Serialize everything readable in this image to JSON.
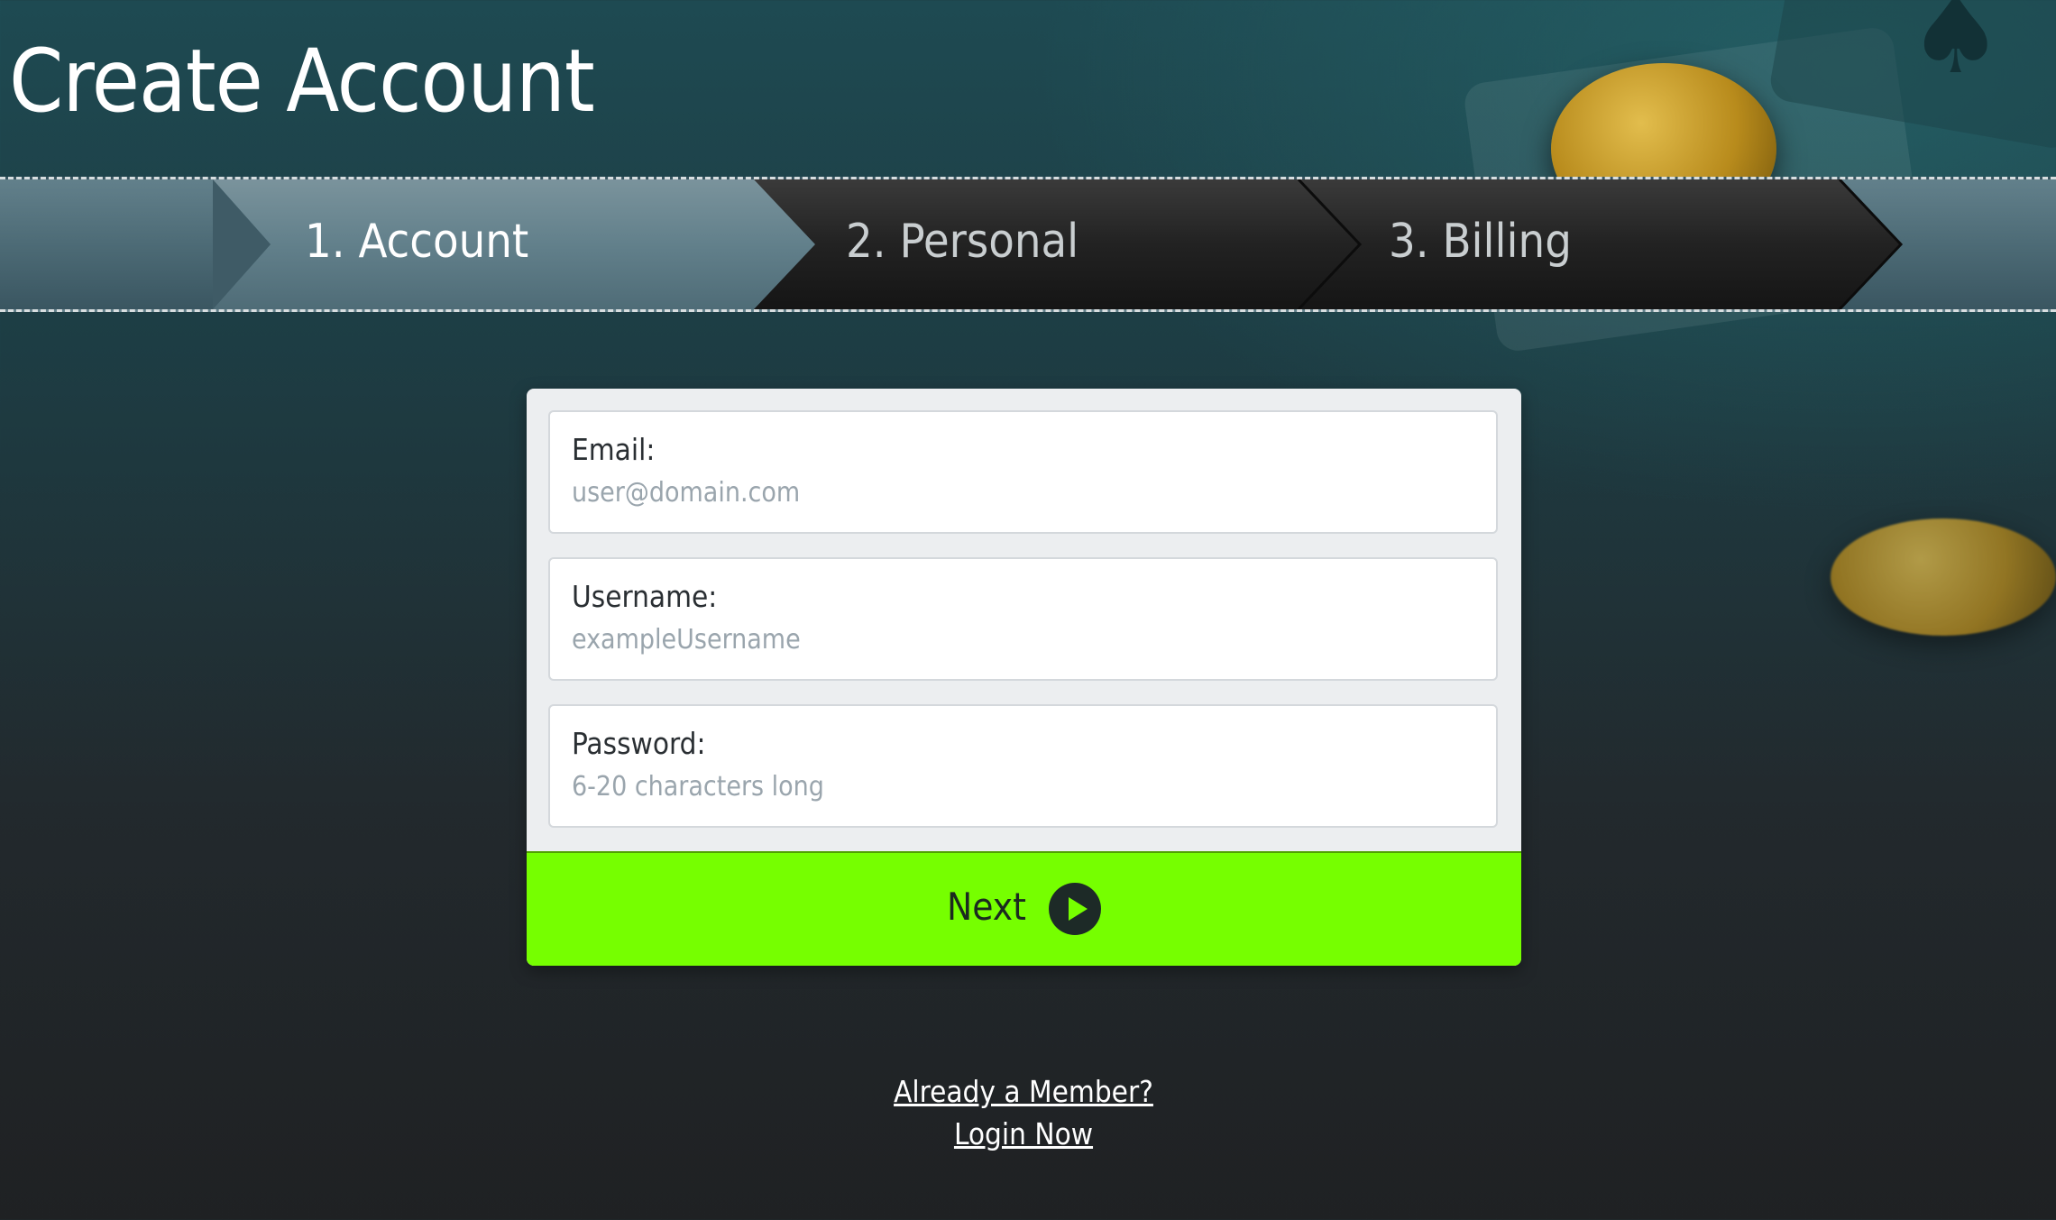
{
  "page": {
    "title": "Create Account"
  },
  "steps": [
    {
      "label": "1. Account",
      "active": true
    },
    {
      "label": "2. Personal",
      "active": false
    },
    {
      "label": "3. Billing",
      "active": false
    }
  ],
  "form": {
    "email": {
      "label": "Email:",
      "placeholder": "user@domain.com",
      "value": ""
    },
    "username": {
      "label": "Username:",
      "placeholder": "exampleUsername",
      "value": ""
    },
    "password": {
      "label": "Password:",
      "placeholder": "6-20 characters long",
      "value": ""
    },
    "next_label": "Next",
    "next_icon": "play-circle-icon"
  },
  "footer": {
    "already_member": "Already a Member?",
    "login_now": "Login Now"
  },
  "colors": {
    "accent": "#76ff00",
    "active_step": "#5a7782",
    "inactive_step": "#1c1c1c"
  }
}
